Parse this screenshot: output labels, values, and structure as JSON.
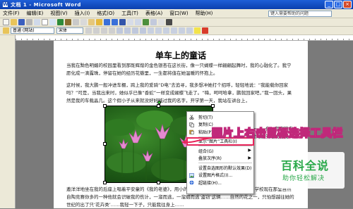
{
  "titlebar": {
    "title": "文档 1 - Microsoft Word",
    "app_icon": "W"
  },
  "window_buttons": {
    "minimize": "_",
    "maximize": "□",
    "close": "×"
  },
  "menus": [
    "文件(F)",
    "编辑(E)",
    "视图(V)",
    "插入(I)",
    "格式(O)",
    "工具(T)",
    "表格(A)",
    "窗口(W)",
    "帮助(H)"
  ],
  "help_placeholder": "键入需要帮助的问题",
  "toolbar": {
    "style_value": "普通 (网站)",
    "font_value": "宋体"
  },
  "document": {
    "title": "单车上的童话",
    "p1": "当我在黝色明媚的校园里看到那既辉煌的金色银杏在这长街，像一只蝴蝶一样翩翩起舞时，我的心融化了。我宁愿化成一滴露珠，停留在她的经历花瓣里，一生都将值在她温暖的怀抱上。",
    "p2": "这时候，我大鹏一般冲进车棚，跨上我的爱骑“D电”去追寻，我多想冲她打个招呼，轻轻地说：“我能载你回家吗？”可是，当我出来时，她似乎已像“香蛇”一样变成蝴蝶飞走了。“嗨，呵呵哈拿，鹏就回家吧，”我一回头，果然是我的车载晶几。这个假小子从来就没好好喊过我的名字，开学第一天，我站在讲台上，",
    "side": "一种自闭、一一一化，我嘲的自习里，她也对她变笑地说着我是……",
    "p3": "邀洋洋地坐在我的后座上唱着平安童的《我的老婆》，用小的凤凰心像被猫抓了一下，她说：“学校现在那里自然自陶竞赛你多的一种他就会识破我的伤计，一溜而逃，一溜烟而逃‘盗窃’这辆……自然的花之一，只怕想越往她的世纪的出了只‘花卉类’……我轻一下子，只能我往身上……"
  },
  "context_menu": {
    "items": [
      {
        "label": "剪切(T)",
        "icon": "scissors-icon"
      },
      {
        "label": "复制(C)",
        "icon": "copy-icon"
      },
      {
        "label": "粘贴(P)",
        "icon": "paste-icon"
      },
      {
        "label": "显示“图片”工具栏(I)",
        "icon": ""
      },
      {
        "label": "组合(G)",
        "icon": "",
        "submenu": true
      },
      {
        "label": "叠放次序(R)",
        "icon": "",
        "submenu": true
      },
      {
        "label": "设置自选图形的默认效果(D)",
        "icon": ""
      },
      {
        "label": "设置图片格式(I)...",
        "icon": "format-picture-icon"
      },
      {
        "label": "超链接(H)...",
        "icon": "hyperlink-icon"
      }
    ]
  },
  "callout_text": "图片上右击鼠标选择工具栏",
  "watermark": {
    "main": "百科全说",
    "sub": "助你轻松解决"
  },
  "colors": {
    "title_blue": "#0b3fae",
    "callout_pink": "#c0287a",
    "highlight_border": "#e8255a",
    "watermark_green": "#2aa94a"
  }
}
